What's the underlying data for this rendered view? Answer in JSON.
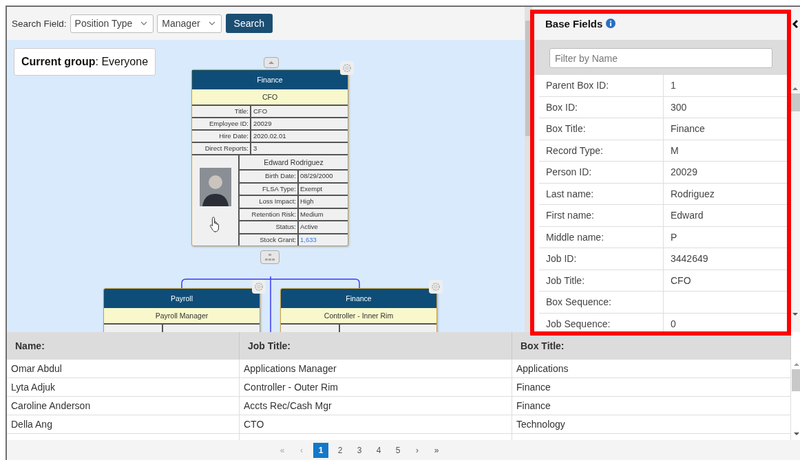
{
  "search": {
    "label": "Search Field:",
    "fields": [
      {
        "value": "Position Type"
      },
      {
        "value": "Manager"
      }
    ],
    "button": "Search"
  },
  "current_group": {
    "text": "**Current group**: Everyone"
  },
  "org_chart": {
    "root": {
      "department": "Finance",
      "position": "CFO",
      "fields": [
        {
          "label": "Title:",
          "value": "CFO"
        },
        {
          "label": "Employee ID:",
          "value": "20029"
        },
        {
          "label": "Hire Date:",
          "value": "2020.02.01"
        },
        {
          "label": "Direct Reports:",
          "value": "3"
        }
      ],
      "name": "Edward Rodriguez",
      "details": [
        {
          "label": "Birth Date:",
          "value": "08/29/2000",
          "kind": "text"
        },
        {
          "label": "FLSA Type:",
          "value": "Exempt",
          "kind": "text"
        },
        {
          "label": "Loss Impact:",
          "value": "High",
          "kind": "text"
        },
        {
          "label": "Retention Risk:",
          "value": "Medium",
          "kind": "text"
        },
        {
          "label": "Status:",
          "value": "Active",
          "kind": "text"
        },
        {
          "label": "Stock Grant:",
          "value": "1,633",
          "kind": "link"
        }
      ]
    },
    "children": [
      {
        "department": "Payroll",
        "position": "Payroll Manager"
      },
      {
        "department": "Finance",
        "position": "Controller - Inner Rim"
      }
    ]
  },
  "panel": {
    "title": "Base Fields",
    "filter": {
      "placeholder": "Filter by Name"
    },
    "rows": [
      {
        "label": "Parent Box ID:",
        "value": "1"
      },
      {
        "label": "Box ID:",
        "value": "300"
      },
      {
        "label": "Box Title:",
        "value": "Finance"
      },
      {
        "label": "Record Type:",
        "value": "M"
      },
      {
        "label": "Person ID:",
        "value": "20029"
      },
      {
        "label": "Last name:",
        "value": "Rodriguez"
      },
      {
        "label": "First name:",
        "value": "Edward"
      },
      {
        "label": "Middle name:",
        "value": "P"
      },
      {
        "label": "Job ID:",
        "value": "3442649"
      },
      {
        "label": "Job Title:",
        "value": "CFO"
      },
      {
        "label": "Box Sequence:",
        "value": ""
      },
      {
        "label": "Job Sequence:",
        "value": "0"
      }
    ]
  },
  "table": {
    "columns": [
      "Name:",
      "Job Title:",
      "Box Title:"
    ],
    "rows": [
      [
        "Omar Abdul",
        "Applications Manager",
        "Applications"
      ],
      [
        "Lyta Adjuk",
        "Controller - Outer Rim",
        "Finance"
      ],
      [
        "Caroline Anderson",
        "Accts Rec/Cash Mgr",
        "Finance"
      ],
      [
        "Della Ang",
        "CTO",
        "Technology"
      ]
    ]
  },
  "pagination": {
    "first": "«",
    "prev": "‹",
    "pages": [
      {
        "label": "1",
        "selected": true
      },
      {
        "label": "2",
        "selected": false
      },
      {
        "label": "3",
        "selected": false
      },
      {
        "label": "4",
        "selected": false
      },
      {
        "label": "5",
        "selected": false
      }
    ],
    "next": "›",
    "last": "»"
  }
}
